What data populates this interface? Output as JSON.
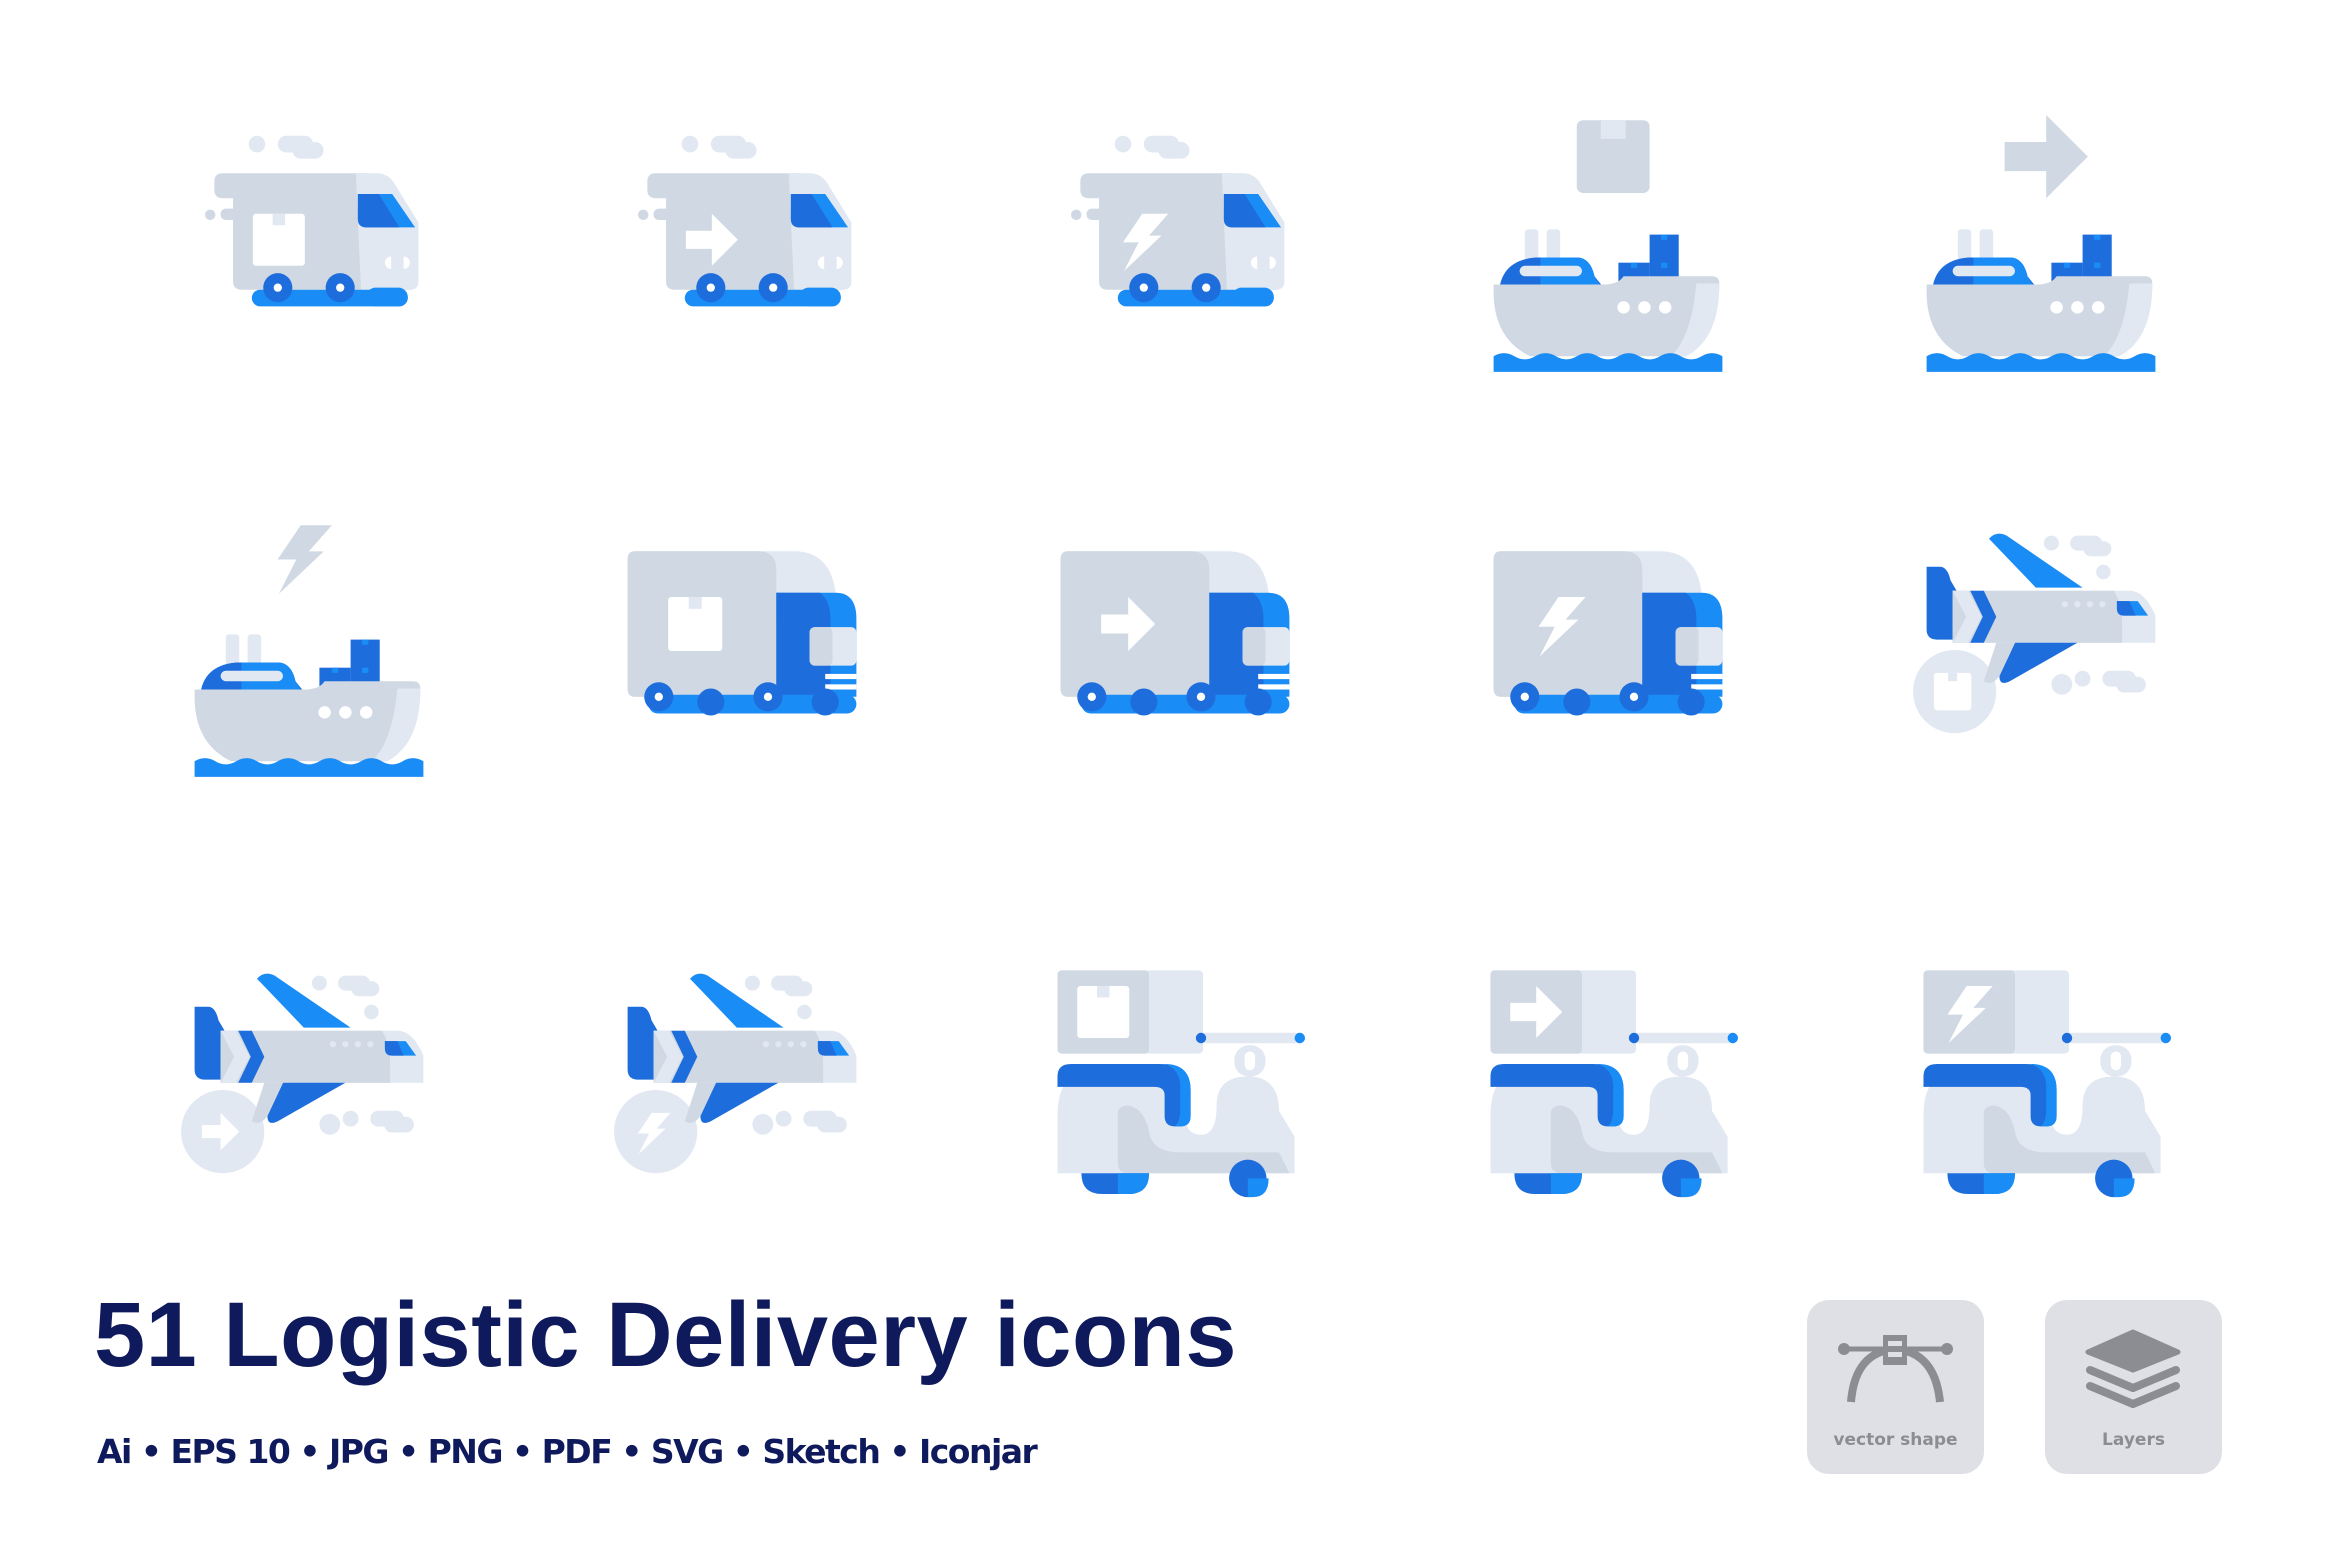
{
  "colors": {
    "blue": "#1a8cf5",
    "dark_blue": "#1e6ddc",
    "gray": "#cfd8e3",
    "light_gray": "#e1e8f2",
    "white": "#ffffff",
    "title": "#0f1a5c",
    "badge_bg": "#dfe0e5",
    "badge_fg": "#8b8d92"
  },
  "icons": [
    {
      "name": "van-box-icon",
      "vehicle": "van",
      "badge": "box"
    },
    {
      "name": "van-arrow-icon",
      "vehicle": "van",
      "badge": "arrow"
    },
    {
      "name": "van-lightning-icon",
      "vehicle": "van",
      "badge": "lightning"
    },
    {
      "name": "ship-box-icon",
      "vehicle": "ship",
      "badge": "box"
    },
    {
      "name": "ship-arrow-icon",
      "vehicle": "ship",
      "badge": "arrow"
    },
    {
      "name": "ship-lightning-icon",
      "vehicle": "ship",
      "badge": "lightning"
    },
    {
      "name": "truck-box-icon",
      "vehicle": "truck",
      "badge": "box"
    },
    {
      "name": "truck-arrow-icon",
      "vehicle": "truck",
      "badge": "arrow"
    },
    {
      "name": "truck-lightning-icon",
      "vehicle": "truck",
      "badge": "lightning"
    },
    {
      "name": "plane-box-icon",
      "vehicle": "plane",
      "badge": "box"
    },
    {
      "name": "plane-arrow-icon",
      "vehicle": "plane",
      "badge": "arrow"
    },
    {
      "name": "plane-lightning-icon",
      "vehicle": "plane",
      "badge": "lightning"
    },
    {
      "name": "scooter-box-icon",
      "vehicle": "scooter",
      "badge": "box"
    },
    {
      "name": "scooter-arrow-icon",
      "vehicle": "scooter",
      "badge": "arrow"
    },
    {
      "name": "scooter-lightning-icon",
      "vehicle": "scooter",
      "badge": "lightning"
    }
  ],
  "title": "51 Logistic Delivery icons",
  "formats": [
    "Ai",
    "EPS 10",
    "JPG",
    "PNG",
    "PDF",
    "SVG",
    "Sketch",
    "Iconjar"
  ],
  "format_separator": "•",
  "badges": [
    {
      "icon": "vector-shape-icon",
      "label": "vector shape"
    },
    {
      "icon": "layers-icon",
      "label": "Layers"
    }
  ]
}
